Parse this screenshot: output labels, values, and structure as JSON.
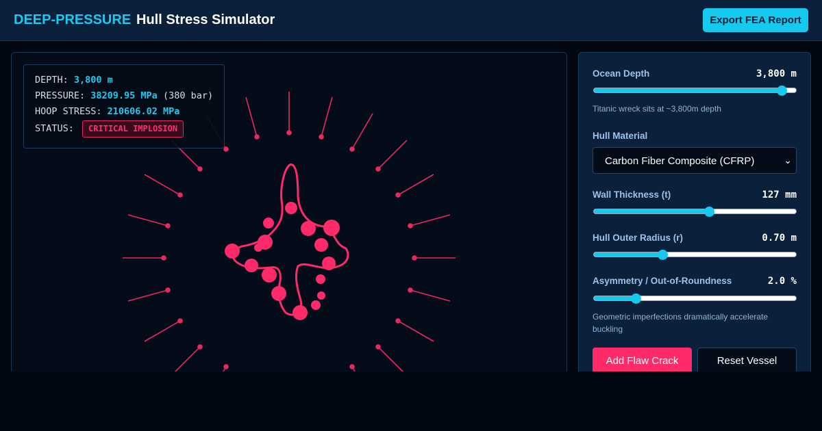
{
  "header": {
    "brand": "DEEP-PRESSURE",
    "title": "Hull Stress Simulator",
    "export_label": "Export FEA Report"
  },
  "readout": {
    "depth_label": "DEPTH: ",
    "depth_value": "3,800 m",
    "pressure_label": "PRESSURE: ",
    "pressure_value": "38209.95 MPa",
    "pressure_bar": "(380 bar)",
    "hoop_label": "HOOP STRESS: ",
    "hoop_value": "210606.02 MPa",
    "status_label": "STATUS:",
    "status_value": "CRITICAL IMPLOSION"
  },
  "controls": {
    "depth": {
      "label": "Ocean Depth",
      "value": "3,800 m",
      "fraction": 0.93,
      "hint": "Titanic wreck sits at ~3,800m depth"
    },
    "material": {
      "label": "Hull Material",
      "selected": "Carbon Fiber Composite (CFRP)"
    },
    "thickness": {
      "label": "Wall Thickness (t)",
      "value": "127 mm",
      "fraction": 0.57
    },
    "radius": {
      "label": "Hull Outer Radius (r)",
      "value": "0.70 m",
      "fraction": 0.34
    },
    "asymmetry": {
      "label": "Asymmetry / Out-of-Roundness",
      "value": "2.0 %",
      "fraction": 0.21,
      "hint": "Geometric imperfections dramatically accelerate buckling"
    }
  },
  "actions": {
    "flaw_label": "Add Flaw Crack",
    "reset_label": "Reset Vessel"
  },
  "colors": {
    "accent": "#16c9ef",
    "danger": "#ff2a6a",
    "panel": "#0b203a",
    "background": "#020812"
  },
  "icons": {
    "select_arrow": "chevron-down-icon"
  }
}
